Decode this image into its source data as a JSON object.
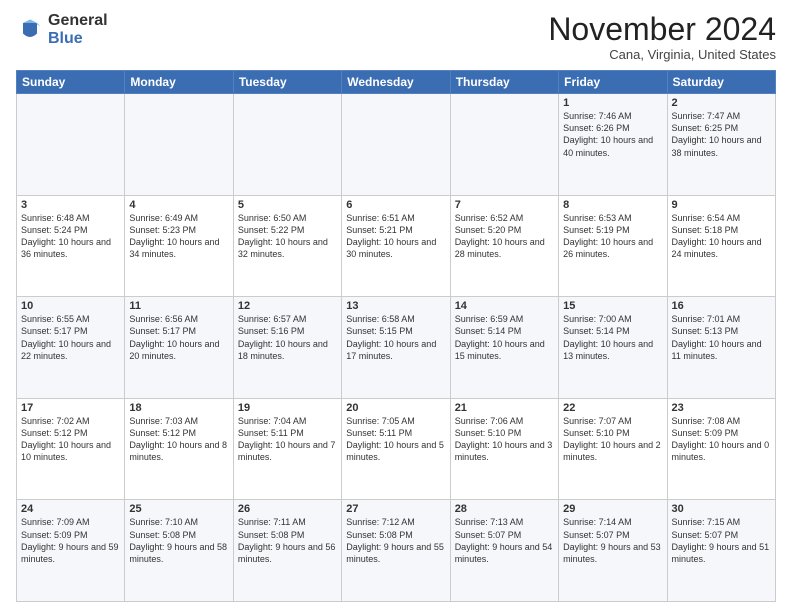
{
  "header": {
    "logo_general": "General",
    "logo_blue": "Blue",
    "month_title": "November 2024",
    "location": "Cana, Virginia, United States"
  },
  "days_of_week": [
    "Sunday",
    "Monday",
    "Tuesday",
    "Wednesday",
    "Thursday",
    "Friday",
    "Saturday"
  ],
  "weeks": [
    [
      {
        "day": "",
        "text": ""
      },
      {
        "day": "",
        "text": ""
      },
      {
        "day": "",
        "text": ""
      },
      {
        "day": "",
        "text": ""
      },
      {
        "day": "",
        "text": ""
      },
      {
        "day": "1",
        "text": "Sunrise: 7:46 AM\nSunset: 6:26 PM\nDaylight: 10 hours and 40 minutes."
      },
      {
        "day": "2",
        "text": "Sunrise: 7:47 AM\nSunset: 6:25 PM\nDaylight: 10 hours and 38 minutes."
      }
    ],
    [
      {
        "day": "3",
        "text": "Sunrise: 6:48 AM\nSunset: 5:24 PM\nDaylight: 10 hours and 36 minutes."
      },
      {
        "day": "4",
        "text": "Sunrise: 6:49 AM\nSunset: 5:23 PM\nDaylight: 10 hours and 34 minutes."
      },
      {
        "day": "5",
        "text": "Sunrise: 6:50 AM\nSunset: 5:22 PM\nDaylight: 10 hours and 32 minutes."
      },
      {
        "day": "6",
        "text": "Sunrise: 6:51 AM\nSunset: 5:21 PM\nDaylight: 10 hours and 30 minutes."
      },
      {
        "day": "7",
        "text": "Sunrise: 6:52 AM\nSunset: 5:20 PM\nDaylight: 10 hours and 28 minutes."
      },
      {
        "day": "8",
        "text": "Sunrise: 6:53 AM\nSunset: 5:19 PM\nDaylight: 10 hours and 26 minutes."
      },
      {
        "day": "9",
        "text": "Sunrise: 6:54 AM\nSunset: 5:18 PM\nDaylight: 10 hours and 24 minutes."
      }
    ],
    [
      {
        "day": "10",
        "text": "Sunrise: 6:55 AM\nSunset: 5:17 PM\nDaylight: 10 hours and 22 minutes."
      },
      {
        "day": "11",
        "text": "Sunrise: 6:56 AM\nSunset: 5:17 PM\nDaylight: 10 hours and 20 minutes."
      },
      {
        "day": "12",
        "text": "Sunrise: 6:57 AM\nSunset: 5:16 PM\nDaylight: 10 hours and 18 minutes."
      },
      {
        "day": "13",
        "text": "Sunrise: 6:58 AM\nSunset: 5:15 PM\nDaylight: 10 hours and 17 minutes."
      },
      {
        "day": "14",
        "text": "Sunrise: 6:59 AM\nSunset: 5:14 PM\nDaylight: 10 hours and 15 minutes."
      },
      {
        "day": "15",
        "text": "Sunrise: 7:00 AM\nSunset: 5:14 PM\nDaylight: 10 hours and 13 minutes."
      },
      {
        "day": "16",
        "text": "Sunrise: 7:01 AM\nSunset: 5:13 PM\nDaylight: 10 hours and 11 minutes."
      }
    ],
    [
      {
        "day": "17",
        "text": "Sunrise: 7:02 AM\nSunset: 5:12 PM\nDaylight: 10 hours and 10 minutes."
      },
      {
        "day": "18",
        "text": "Sunrise: 7:03 AM\nSunset: 5:12 PM\nDaylight: 10 hours and 8 minutes."
      },
      {
        "day": "19",
        "text": "Sunrise: 7:04 AM\nSunset: 5:11 PM\nDaylight: 10 hours and 7 minutes."
      },
      {
        "day": "20",
        "text": "Sunrise: 7:05 AM\nSunset: 5:11 PM\nDaylight: 10 hours and 5 minutes."
      },
      {
        "day": "21",
        "text": "Sunrise: 7:06 AM\nSunset: 5:10 PM\nDaylight: 10 hours and 3 minutes."
      },
      {
        "day": "22",
        "text": "Sunrise: 7:07 AM\nSunset: 5:10 PM\nDaylight: 10 hours and 2 minutes."
      },
      {
        "day": "23",
        "text": "Sunrise: 7:08 AM\nSunset: 5:09 PM\nDaylight: 10 hours and 0 minutes."
      }
    ],
    [
      {
        "day": "24",
        "text": "Sunrise: 7:09 AM\nSunset: 5:09 PM\nDaylight: 9 hours and 59 minutes."
      },
      {
        "day": "25",
        "text": "Sunrise: 7:10 AM\nSunset: 5:08 PM\nDaylight: 9 hours and 58 minutes."
      },
      {
        "day": "26",
        "text": "Sunrise: 7:11 AM\nSunset: 5:08 PM\nDaylight: 9 hours and 56 minutes."
      },
      {
        "day": "27",
        "text": "Sunrise: 7:12 AM\nSunset: 5:08 PM\nDaylight: 9 hours and 55 minutes."
      },
      {
        "day": "28",
        "text": "Sunrise: 7:13 AM\nSunset: 5:07 PM\nDaylight: 9 hours and 54 minutes."
      },
      {
        "day": "29",
        "text": "Sunrise: 7:14 AM\nSunset: 5:07 PM\nDaylight: 9 hours and 53 minutes."
      },
      {
        "day": "30",
        "text": "Sunrise: 7:15 AM\nSunset: 5:07 PM\nDaylight: 9 hours and 51 minutes."
      }
    ]
  ]
}
